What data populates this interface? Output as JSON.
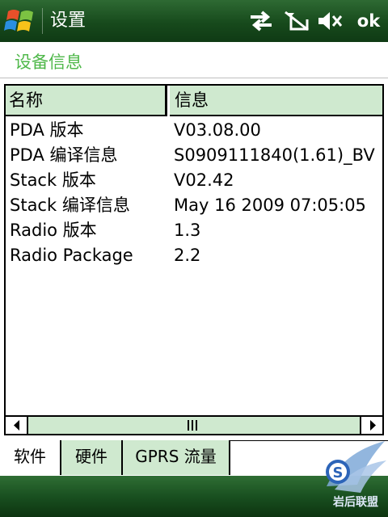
{
  "titlebar": {
    "title": "设置",
    "ok_label": "ok",
    "icons": [
      "windows-start-icon",
      "connectivity-icon",
      "no-signal-icon",
      "volume-muted-icon"
    ],
    "bg_color": "#174a1c"
  },
  "section": {
    "title": "设备信息",
    "title_color": "#4fb84a"
  },
  "listview": {
    "columns": [
      "名称",
      "信息"
    ],
    "rows": [
      {
        "name": "PDA 版本",
        "info": "V03.08.00"
      },
      {
        "name": "PDA 编译信息",
        "info": "S0909111840(1.61)_BV"
      },
      {
        "name": "Stack 版本",
        "info": "V02.42"
      },
      {
        "name": "Stack 编译信息",
        "info": "May 16 2009 07:05:05"
      },
      {
        "name": "Radio 版本",
        "info": "1.3"
      },
      {
        "name": "Radio Package",
        "info": "2.2"
      }
    ],
    "header_color": "#cfe9cf"
  },
  "scrollbar": {
    "thumb_glyph": "|||"
  },
  "tabs": [
    {
      "label": "软件",
      "active": true
    },
    {
      "label": "硬件",
      "active": false
    },
    {
      "label": "GPRS 流量",
      "active": false
    }
  ],
  "watermark": {
    "text": "岩后联盟"
  }
}
